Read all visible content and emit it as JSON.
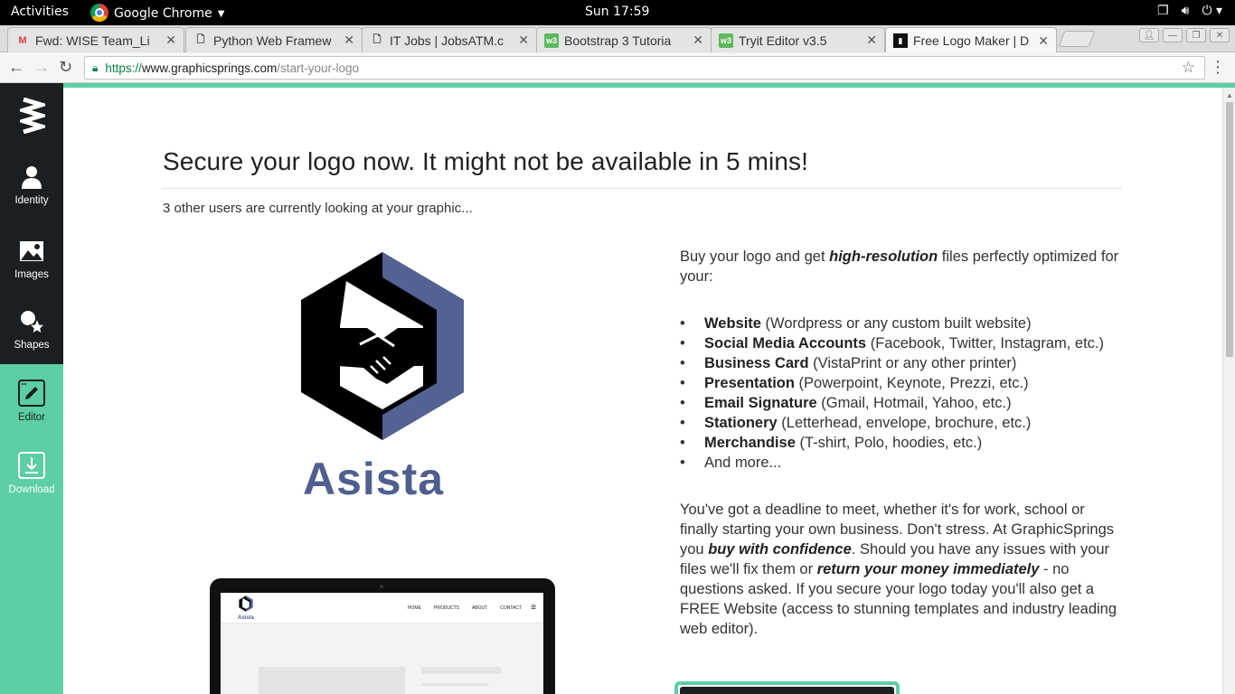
{
  "topbar": {
    "activities": "Activities",
    "app_name": "Google Chrome",
    "clock": "Sun 17:59"
  },
  "tabs": [
    {
      "title": "Fwd: WISE Team_Li",
      "icon": "gmail-icon"
    },
    {
      "title": "Python Web Framew",
      "icon": "page-icon"
    },
    {
      "title": "IT Jobs | JobsATM.c",
      "icon": "page-icon"
    },
    {
      "title": "Bootstrap 3 Tutoria",
      "icon": "w3schools-icon"
    },
    {
      "title": "Tryit Editor v3.5",
      "icon": "w3schools-icon"
    },
    {
      "title": "Free Logo Maker | D",
      "icon": "graphicsprings-icon",
      "active": true
    }
  ],
  "address": {
    "scheme": "https://",
    "host": "www.graphicsprings.com",
    "path": "/start-your-logo"
  },
  "sidebar": {
    "items": [
      {
        "label": "Identity",
        "icon": "person-icon"
      },
      {
        "label": "Images",
        "icon": "image-icon"
      },
      {
        "label": "Shapes",
        "icon": "shapes-icon"
      },
      {
        "label": "Editor",
        "icon": "edit-icon"
      },
      {
        "label": "Download",
        "icon": "download-icon"
      }
    ]
  },
  "main": {
    "heading": "Secure your logo now. It might not be available in 5 mins!",
    "subline": "3 other users are currently looking at your graphic...",
    "brand_name": "Asista",
    "mockup": {
      "brand": "Asista",
      "nav": [
        "HOME",
        "PRODUCTS",
        "ABOUT",
        "CONTACT"
      ]
    },
    "intro_pre": "Buy your logo and get ",
    "intro_em": "high-resolution",
    "intro_post": " files perfectly optimized for your:",
    "features": [
      {
        "name": "Website",
        "detail": " (Wordpress or any custom built website)"
      },
      {
        "name": "Social Media Accounts",
        "detail": " (Facebook, Twitter, Instagram, etc.)"
      },
      {
        "name": "Business Card",
        "detail": " (VistaPrint or any other printer)"
      },
      {
        "name": "Presentation",
        "detail": " (Powerpoint, Keynote, Prezzi, etc.)"
      },
      {
        "name": "Email Signature",
        "detail": " (Gmail, Hotmail, Yahoo, etc.)"
      },
      {
        "name": "Stationery",
        "detail": " (Letterhead, envelope, brochure, etc.)"
      },
      {
        "name": "Merchandise",
        "detail": " (T-shirt, Polo, hoodies, etc.)"
      },
      {
        "name": "",
        "detail": "And more..."
      }
    ],
    "para2": {
      "a": "You've got a deadline to meet, whether it's for work, school or finally starting your own business. Don't stress. At GraphicSprings you ",
      "b": "buy with confidence",
      "c": ". Should you have any issues with your files we'll fix them or ",
      "d": "return your money immediately",
      "e": " - no questions asked. If you secure your logo today you'll also get a FREE Website (access to stunning templates and industry leading web editor)."
    }
  },
  "colors": {
    "accent": "#5ccfa4",
    "sidebar_dark": "#1b1f22",
    "logo_blue": "#4f5f8f"
  }
}
